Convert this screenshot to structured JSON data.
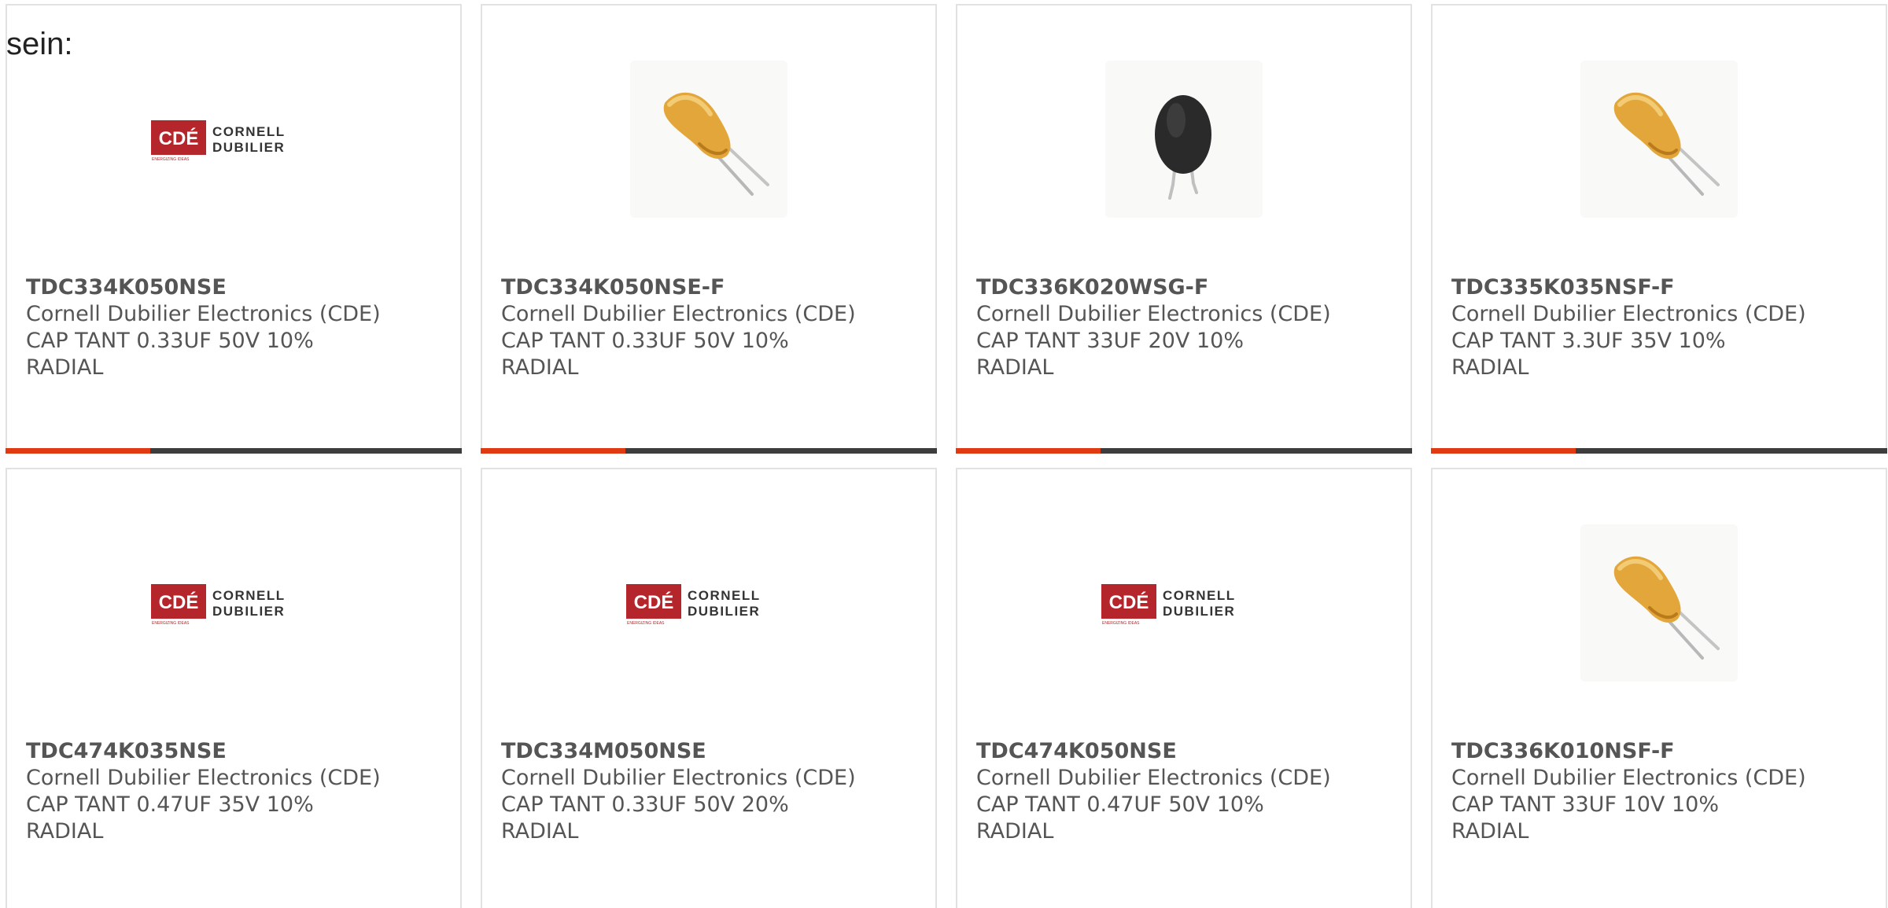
{
  "intro_text": "sein:",
  "colors": {
    "accent": "#e03a12",
    "bar": "#3d3d3d",
    "text": "#555555",
    "cde_red": "#b4262b"
  },
  "cde_logo": {
    "mark": "CDÉ",
    "line1": "CORNELL",
    "line2": "DUBILIER",
    "tagline": "ENERGIZING IDEAS"
  },
  "products": [
    {
      "part_number": "TDC334K050NSE",
      "manufacturer": "Cornell Dubilier Electronics (CDE)",
      "desc1": "CAP TANT 0.33UF 50V 10%",
      "desc2": "RADIAL",
      "image": "cde-logo"
    },
    {
      "part_number": "TDC334K050NSE-F",
      "manufacturer": "Cornell Dubilier Electronics (CDE)",
      "desc1": "CAP TANT 0.33UF 50V 10%",
      "desc2": "RADIAL",
      "image": "yellow-tantalum-capacitor"
    },
    {
      "part_number": "TDC336K020WSG-F",
      "manufacturer": "Cornell Dubilier Electronics (CDE)",
      "desc1": "CAP TANT 33UF 20V 10%",
      "desc2": "RADIAL",
      "image": "black-tantalum-capacitor"
    },
    {
      "part_number": "TDC335K035NSF-F",
      "manufacturer": "Cornell Dubilier Electronics (CDE)",
      "desc1": "CAP TANT 3.3UF 35V 10%",
      "desc2": "RADIAL",
      "image": "yellow-tantalum-capacitor"
    },
    {
      "part_number": "TDC474K035NSE",
      "manufacturer": "Cornell Dubilier Electronics (CDE)",
      "desc1": "CAP TANT 0.47UF 35V 10%",
      "desc2": "RADIAL",
      "image": "cde-logo"
    },
    {
      "part_number": "TDC334M050NSE",
      "manufacturer": "Cornell Dubilier Electronics (CDE)",
      "desc1": "CAP TANT 0.33UF 50V 20%",
      "desc2": "RADIAL",
      "image": "cde-logo"
    },
    {
      "part_number": "TDC474K050NSE",
      "manufacturer": "Cornell Dubilier Electronics (CDE)",
      "desc1": "CAP TANT 0.47UF 50V 10%",
      "desc2": "RADIAL",
      "image": "cde-logo"
    },
    {
      "part_number": "TDC336K010NSF-F",
      "manufacturer": "Cornell Dubilier Electronics (CDE)",
      "desc1": "CAP TANT 33UF 10V 10%",
      "desc2": "RADIAL",
      "image": "yellow-tantalum-capacitor"
    }
  ]
}
